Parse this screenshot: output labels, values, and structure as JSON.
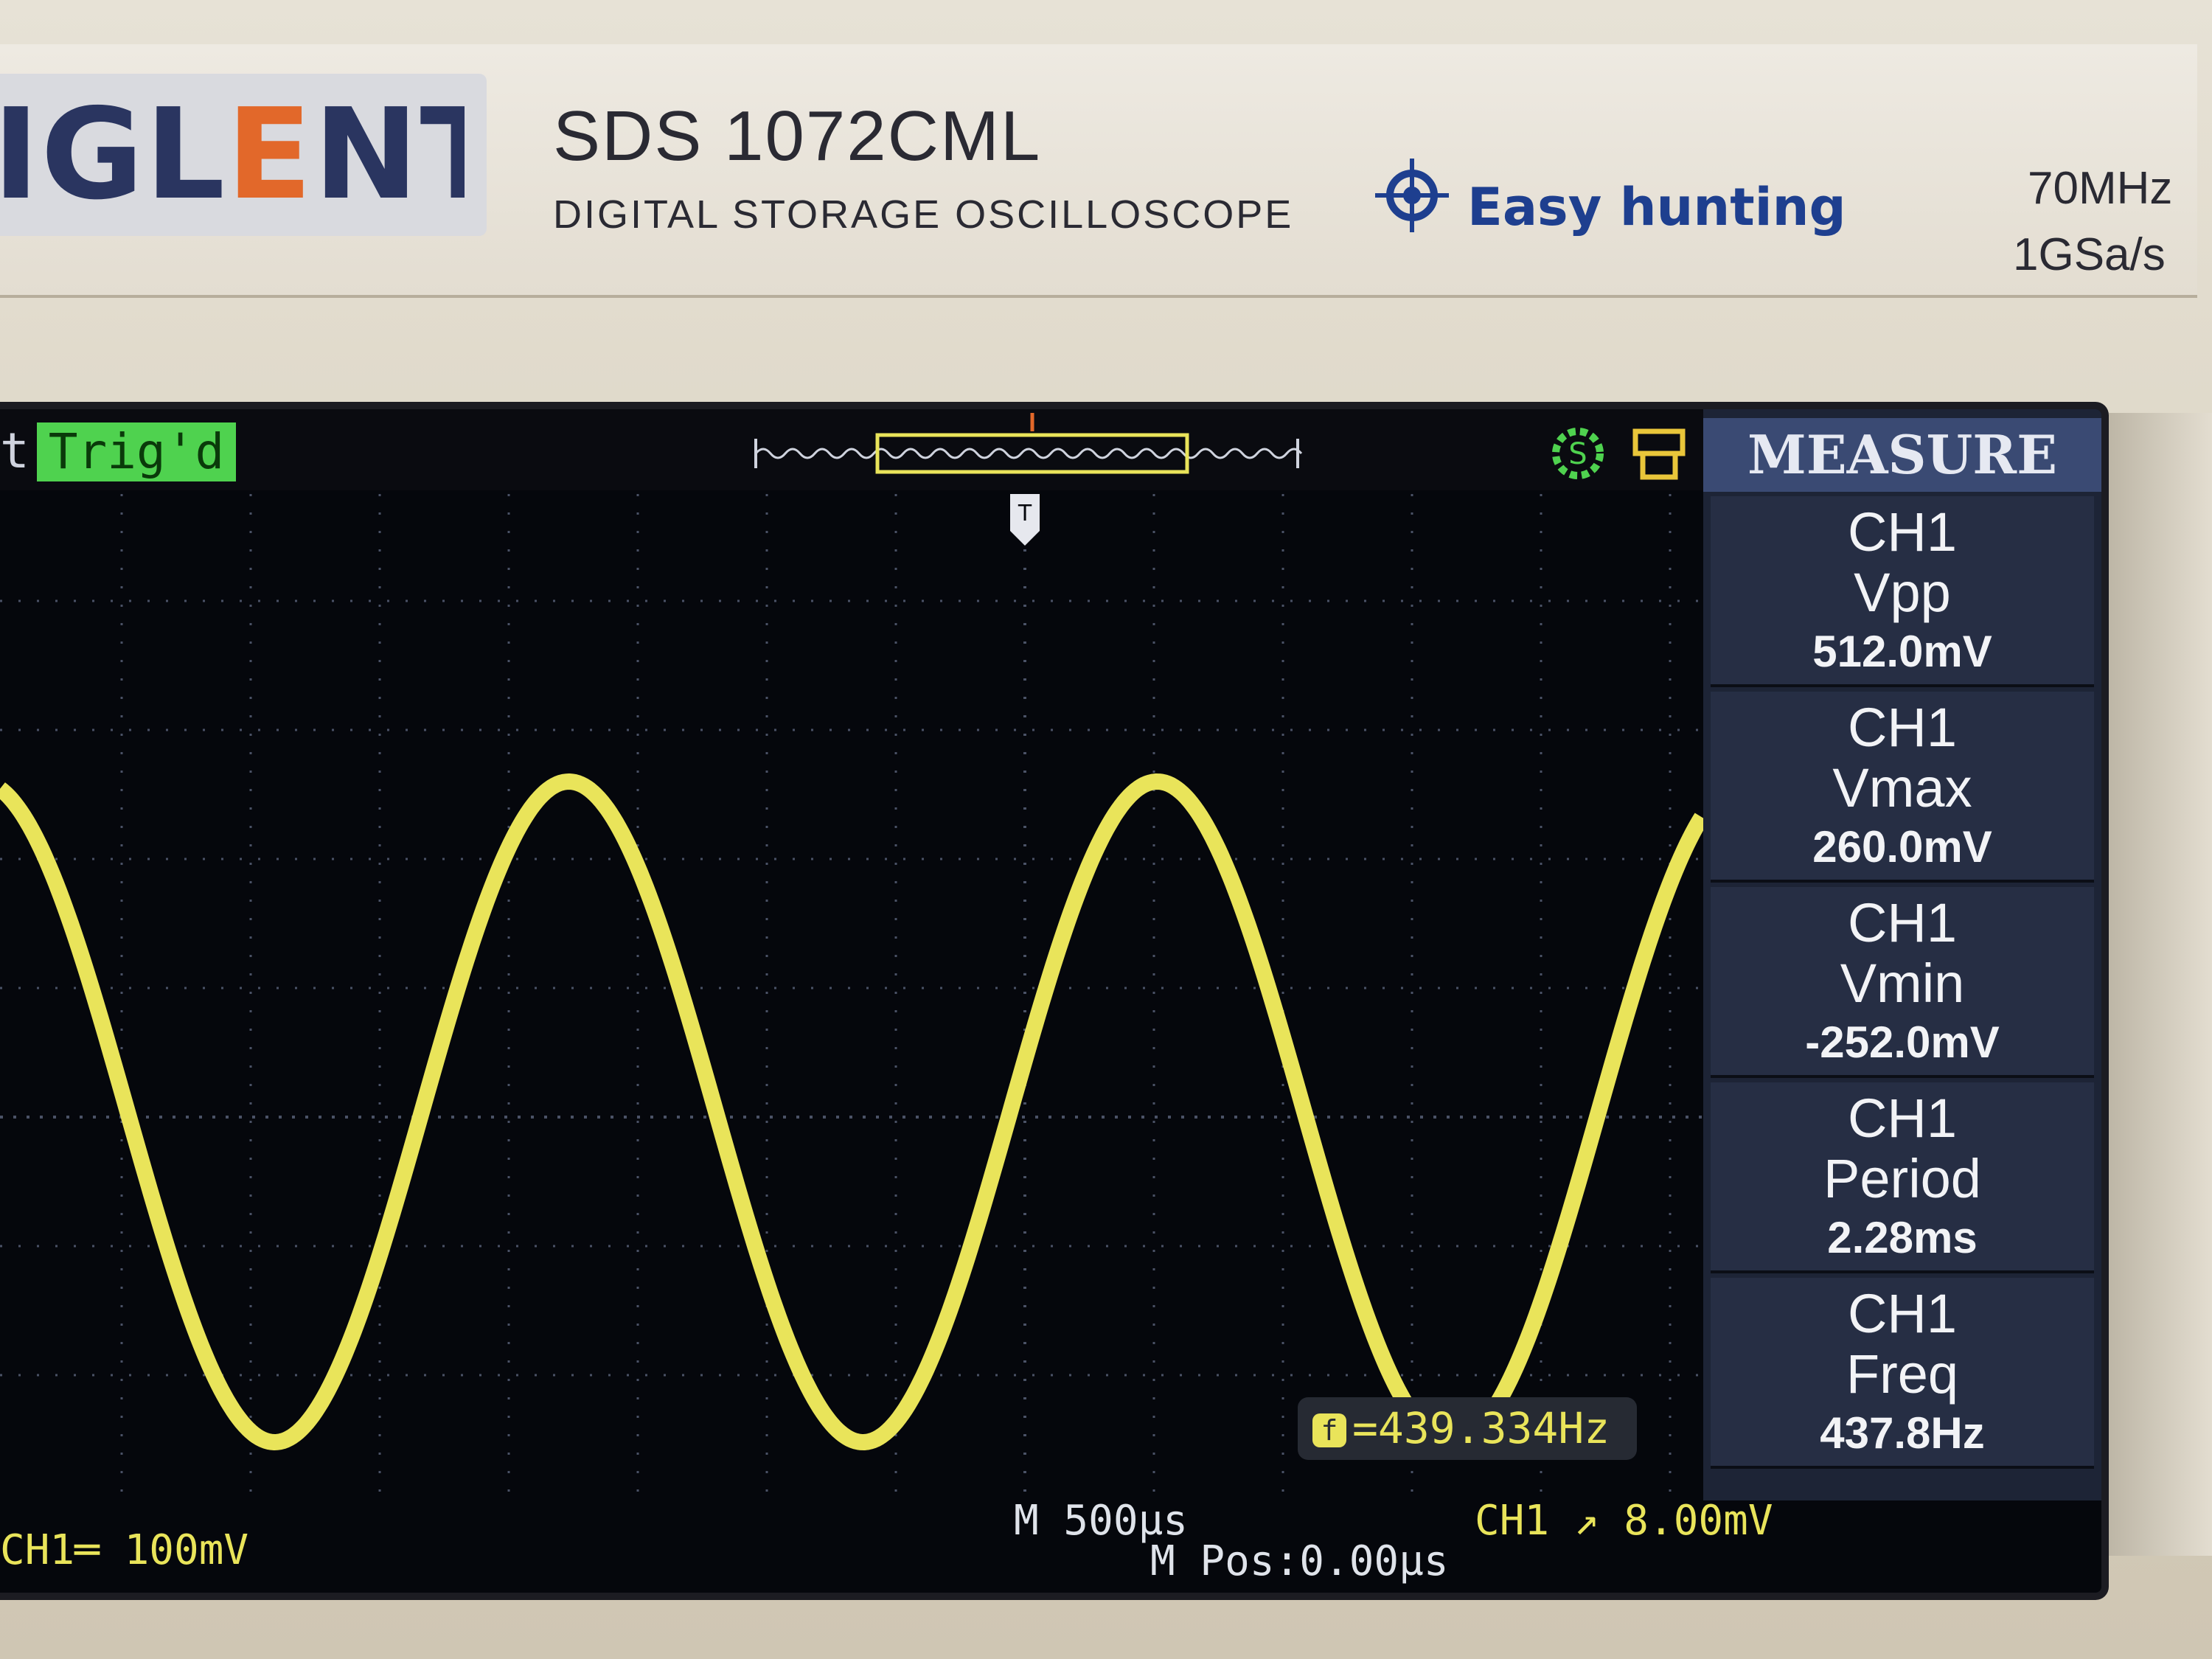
{
  "header": {
    "brand_main": "IGL",
    "brand_accent": "E",
    "brand_end": "NT",
    "model": "SDS 1072CML",
    "subtitle": "DIGITAL STORAGE OSCILLOSCOPE",
    "feature": "Easy hunting",
    "bandwidth": "70MHz",
    "sample_rate": "1GSa/s"
  },
  "status": {
    "prefix": "t",
    "trigger_state": "Trig'd"
  },
  "measure_menu": {
    "title": "MEASURE",
    "items": [
      {
        "channel": "CH1",
        "name": "Vpp",
        "value": "512.0mV"
      },
      {
        "channel": "CH1",
        "name": "Vmax",
        "value": "260.0mV"
      },
      {
        "channel": "CH1",
        "name": "Vmin",
        "value": "-252.0mV"
      },
      {
        "channel": "CH1",
        "name": "Period",
        "value": "2.28ms"
      },
      {
        "channel": "CH1",
        "name": "Freq",
        "value": "437.8Hz"
      }
    ]
  },
  "readouts": {
    "freq_counter_icon": "f",
    "freq_counter": "=439.334Hz",
    "ch1_scale": "CH1═ 100mV",
    "timebase": "M 500μs",
    "position": "M Pos:0.00μs",
    "trigger_level": "CH1 ↗ 8.00mV"
  },
  "waveform": {
    "color": "#e9e45a",
    "background": "#05070c",
    "shape": "sine",
    "vpp_mV": 512,
    "vmax_mV": 260,
    "vmin_mV": -252,
    "period_ms": 2.28,
    "volts_per_div_mV": 100,
    "time_per_div_us": 500
  },
  "icons": {
    "easy_hunting": "crosshair-icon",
    "trigger_marker": "trigger-t-icon",
    "status_1": "settings-s-icon",
    "status_2": "usb-print-icon"
  }
}
